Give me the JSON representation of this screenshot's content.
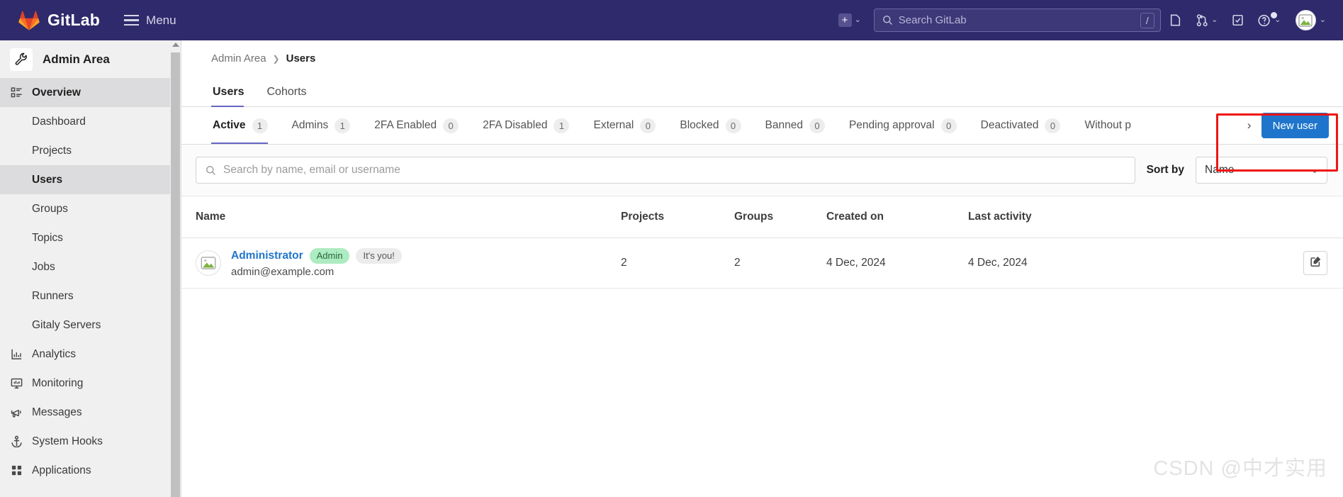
{
  "topnav": {
    "brand": "GitLab",
    "menu_label": "Menu",
    "new_icon": "plus-square-icon",
    "search_placeholder": "Search GitLab",
    "search_value": "",
    "search_shortcut": "/",
    "icons": [
      {
        "name": "issues-icon",
        "glyph": "issues"
      },
      {
        "name": "merge-requests-icon",
        "glyph": "merge"
      },
      {
        "name": "todos-icon",
        "glyph": "todo"
      },
      {
        "name": "help-icon",
        "glyph": "help"
      }
    ]
  },
  "sidebar": {
    "context_title": "Admin Area",
    "context_icon": "wrench-icon",
    "items": [
      {
        "label": "Overview",
        "icon": "overview-icon",
        "type": "top",
        "active": true
      },
      {
        "label": "Dashboard",
        "type": "sub",
        "active": false
      },
      {
        "label": "Projects",
        "type": "sub",
        "active": false
      },
      {
        "label": "Users",
        "type": "sub",
        "active": true
      },
      {
        "label": "Groups",
        "type": "sub",
        "active": false
      },
      {
        "label": "Topics",
        "type": "sub",
        "active": false
      },
      {
        "label": "Jobs",
        "type": "sub",
        "active": false
      },
      {
        "label": "Runners",
        "type": "sub",
        "active": false
      },
      {
        "label": "Gitaly Servers",
        "type": "sub",
        "active": false
      },
      {
        "label": "Analytics",
        "icon": "analytics-icon",
        "type": "top",
        "active": false
      },
      {
        "label": "Monitoring",
        "icon": "monitor-icon",
        "type": "top",
        "active": false
      },
      {
        "label": "Messages",
        "icon": "megaphone-icon",
        "type": "top",
        "active": false
      },
      {
        "label": "System Hooks",
        "icon": "anchor-icon",
        "type": "top",
        "active": false
      },
      {
        "label": "Applications",
        "icon": "grid-icon",
        "type": "top",
        "active": false
      }
    ]
  },
  "breadcrumb": [
    {
      "label": "Admin Area",
      "current": false
    },
    {
      "label": "Users",
      "current": true
    }
  ],
  "page_tabs": [
    {
      "label": "Users",
      "active": true
    },
    {
      "label": "Cohorts",
      "active": false
    }
  ],
  "filter_tabs": [
    {
      "label": "Active",
      "count": "1",
      "active": true
    },
    {
      "label": "Admins",
      "count": "1",
      "active": false
    },
    {
      "label": "2FA Enabled",
      "count": "0",
      "active": false
    },
    {
      "label": "2FA Disabled",
      "count": "1",
      "active": false
    },
    {
      "label": "External",
      "count": "0",
      "active": false
    },
    {
      "label": "Blocked",
      "count": "0",
      "active": false
    },
    {
      "label": "Banned",
      "count": "0",
      "active": false
    },
    {
      "label": "Pending approval",
      "count": "0",
      "active": false
    },
    {
      "label": "Deactivated",
      "count": "0",
      "active": false
    },
    {
      "label": "Without p",
      "count": "",
      "active": false
    }
  ],
  "actions": {
    "scroll_right": "›",
    "new_user_label": "New user"
  },
  "search": {
    "placeholder": "Search by name, email or username",
    "value": "",
    "sort_label": "Sort by",
    "sort_value": "Name"
  },
  "table": {
    "columns": [
      "Name",
      "Projects",
      "Groups",
      "Created on",
      "Last activity",
      ""
    ],
    "rows": [
      {
        "name": "Administrator",
        "badges": [
          "Admin",
          "It's you!"
        ],
        "email": "admin@example.com",
        "projects": "2",
        "groups": "2",
        "created_on": "4 Dec, 2024",
        "last_activity": "4 Dec, 2024",
        "action_icon": "edit-icon"
      }
    ]
  },
  "watermark": "CSDN @中才实用",
  "colors": {
    "nav_bg": "#2f2a6b",
    "accent": "#1f75cb",
    "tab_underline": "#6666c4",
    "highlight_box": "#f01414",
    "admin_badge": "#adebc0"
  }
}
